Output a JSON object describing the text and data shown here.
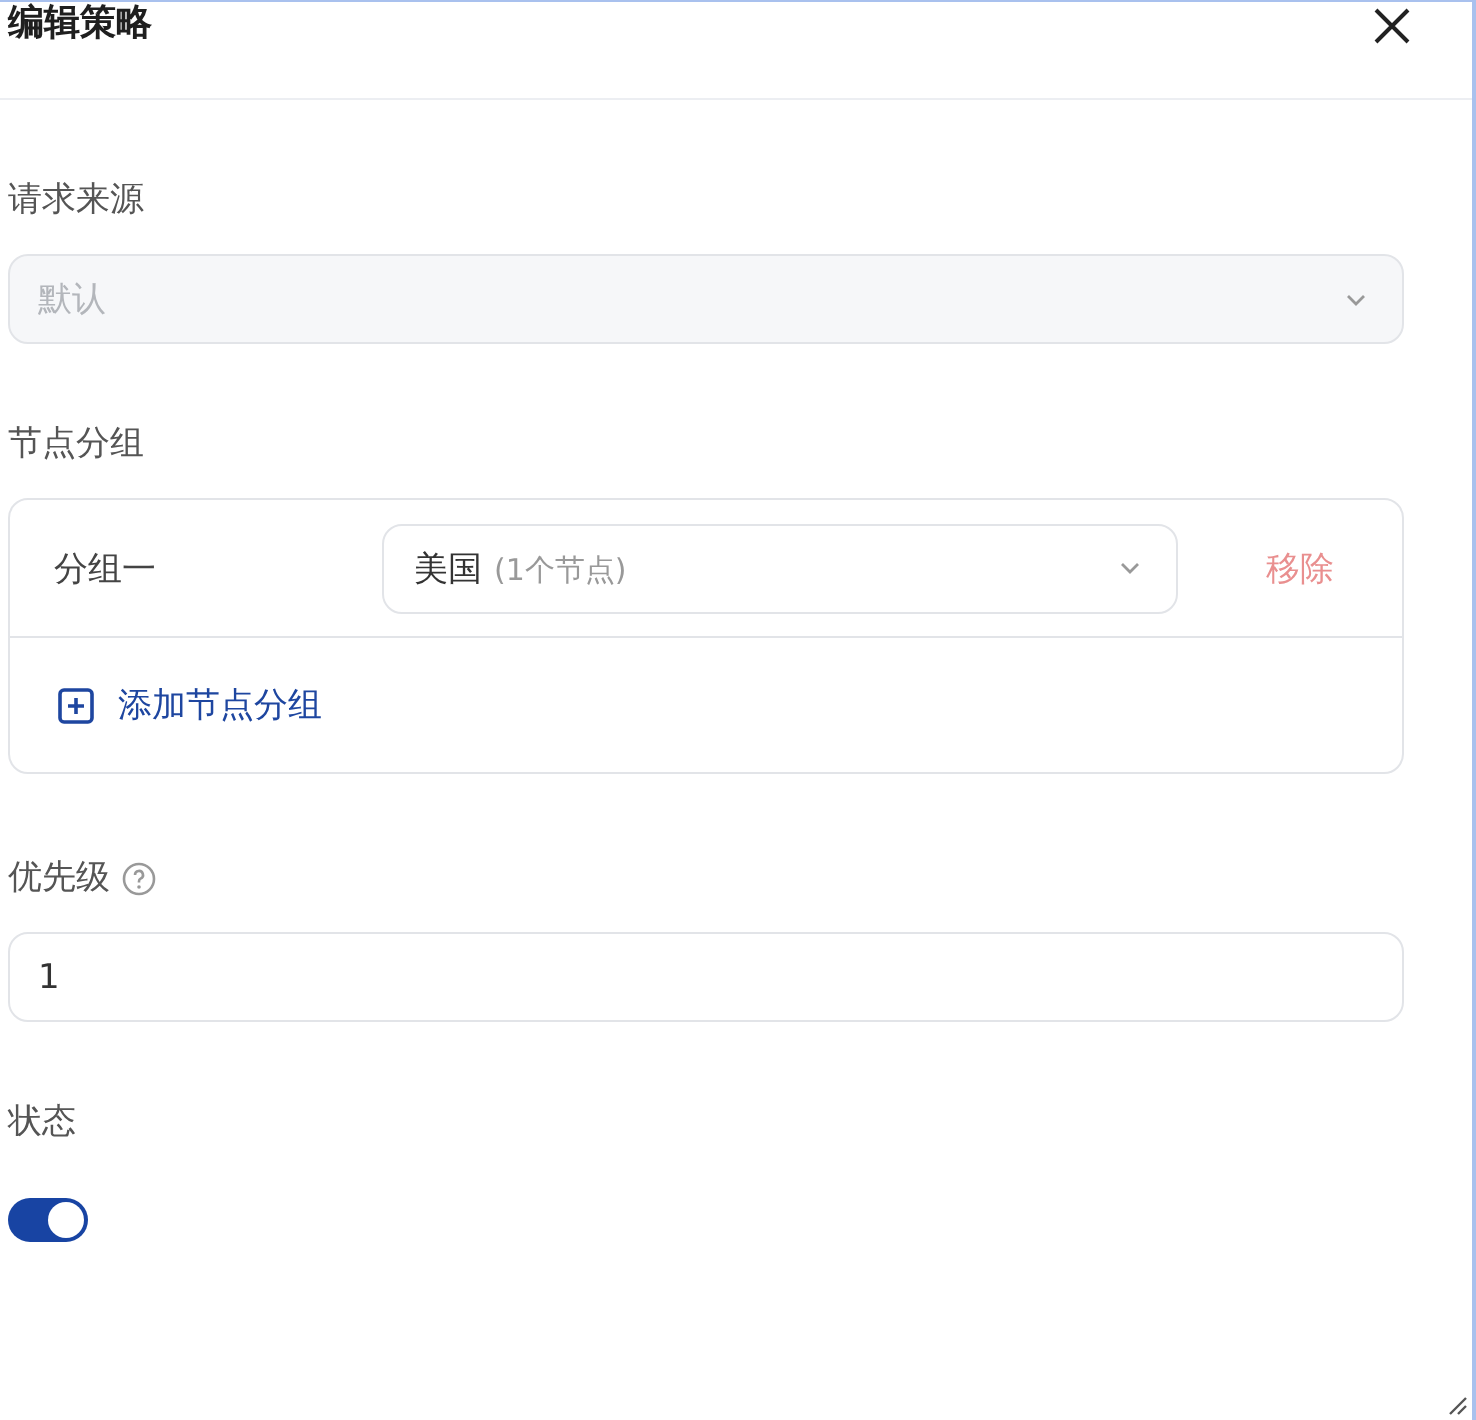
{
  "dialog": {
    "title": "编辑策略"
  },
  "source": {
    "label": "请求来源",
    "value": "默认",
    "disabled": true
  },
  "node_groups": {
    "label": "节点分组",
    "groups": [
      {
        "name": "分组一",
        "value": "美国",
        "count": "(1个节点)",
        "remove": "移除",
        "remove_disabled": true
      }
    ],
    "add": "添加节点分组"
  },
  "priority": {
    "label": "优先级",
    "value": "1"
  },
  "status": {
    "label": "状态",
    "on": true
  }
}
